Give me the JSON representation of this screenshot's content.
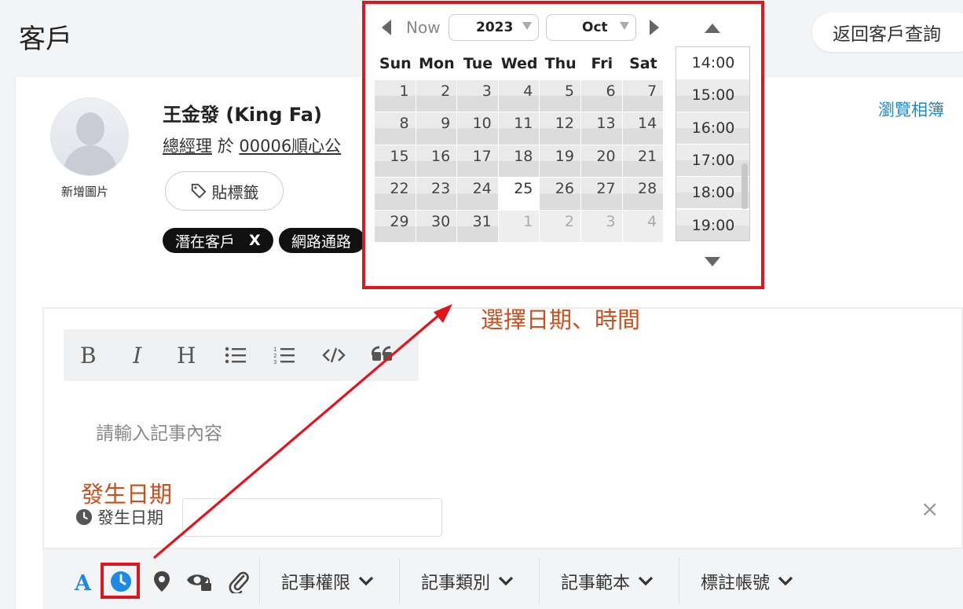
{
  "header": {
    "title": "客戶",
    "back_label": "返回客戶查詢"
  },
  "customer": {
    "avatar_label": "新增圖片",
    "name": "王金發 (King Fa)",
    "role": "總經理",
    "role_sep": "於",
    "company": "00006順心公",
    "tag_button": "貼標籤",
    "tags": [
      {
        "label": "潛在客戶",
        "remove": "X"
      },
      {
        "label": "網路通路"
      }
    ],
    "album_link": "瀏覽相簿"
  },
  "editor": {
    "toolbar": [
      "B",
      "I",
      "H",
      "bullet-list-icon",
      "ordered-list-icon",
      "code-icon",
      "quote-icon"
    ],
    "placeholder": "請輸入記事內容",
    "date_label": "發生日期",
    "date_value": "",
    "close": "×"
  },
  "bottom": {
    "dropdowns": [
      "記事權限",
      "記事類別",
      "記事範本",
      "標註帳號"
    ]
  },
  "annotations": {
    "date_note": "發生日期",
    "select_note": "選擇日期、時間"
  },
  "picker": {
    "now_label": "Now",
    "year": "2023",
    "month": "Oct",
    "weekdays": [
      "Sun",
      "Mon",
      "Tue",
      "Wed",
      "Thu",
      "Fri",
      "Sat"
    ],
    "weeks": [
      [
        "1",
        "2",
        "3",
        "4",
        "5",
        "6",
        "7"
      ],
      [
        "8",
        "9",
        "10",
        "11",
        "12",
        "13",
        "14"
      ],
      [
        "15",
        "16",
        "17",
        "18",
        "19",
        "20",
        "21"
      ],
      [
        "22",
        "23",
        "24",
        "25",
        "26",
        "27",
        "28"
      ],
      [
        "29",
        "30",
        "31",
        "1",
        "2",
        "3",
        "4"
      ]
    ],
    "today": "25",
    "times": [
      "14:00",
      "15:00",
      "16:00",
      "17:00",
      "18:00",
      "19:00"
    ],
    "selected_time": "14:00"
  },
  "colors": {
    "accent": "#1e88e5",
    "highlight": "#e0161f",
    "annotation": "#c8501e",
    "link": "#1e88c8"
  }
}
